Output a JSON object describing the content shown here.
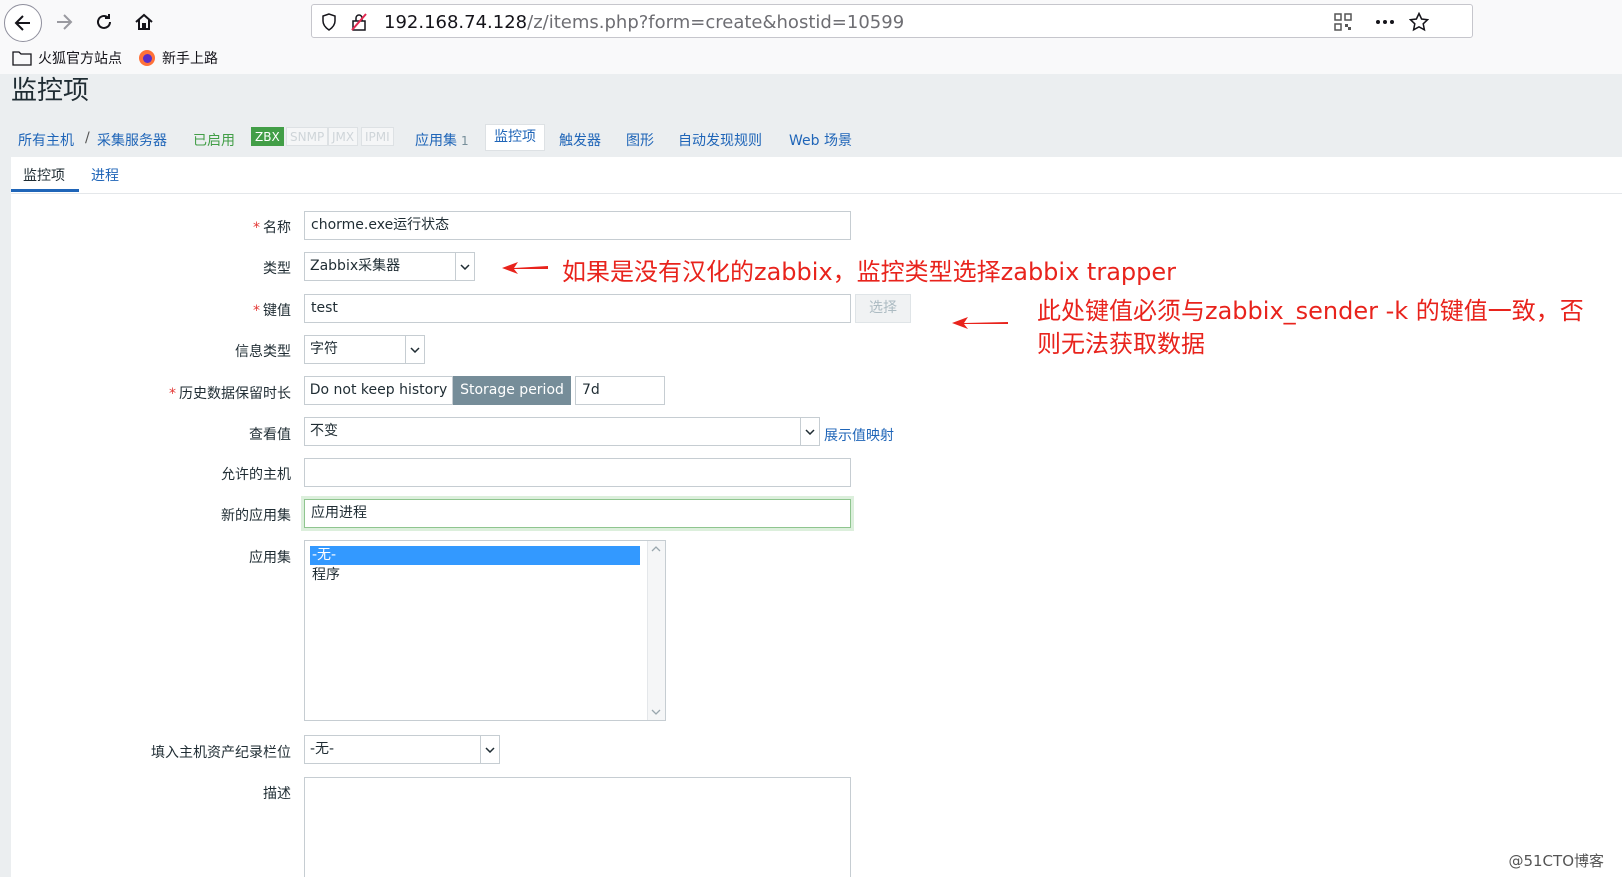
{
  "browser": {
    "url_host": "192.168.74.128",
    "url_path": "/z/items.php?form=create&hostid=10599",
    "bookmarks": [
      "火狐官方站点",
      "新手上路"
    ]
  },
  "page": {
    "title": "监控项"
  },
  "host_nav": {
    "all_hosts": "所有主机",
    "separator": "/",
    "host": "采集服务器",
    "status": "已启用",
    "availability": [
      "ZBX",
      "SNMP",
      "JMX",
      "IPMI"
    ],
    "applications": "应用集",
    "applications_count": "1",
    "items": "监控项",
    "triggers": "触发器",
    "graphs": "图形",
    "discovery": "自动发现规则",
    "web": "Web 场景"
  },
  "tabs": [
    "监控项",
    "进程"
  ],
  "form": {
    "required_mark": "*",
    "name_label": "名称",
    "name_value": "chorme.exe运行状态",
    "type_label": "类型",
    "type_value": "Zabbix采集器",
    "key_label": "键值",
    "key_value": "test",
    "select_button": "选择",
    "info_type_label": "信息类型",
    "info_type_value": "字符",
    "history_label": "历史数据保留时长",
    "history_options": [
      "Do not keep history",
      "Storage period"
    ],
    "history_value": "7d",
    "show_value_label": "查看值",
    "show_value_value": "不变",
    "show_value_link": "展示值映射",
    "allowed_hosts_label": "允许的主机",
    "allowed_hosts_value": "",
    "new_app_label": "新的应用集",
    "new_app_value": "应用进程",
    "apps_label": "应用集",
    "apps_options": [
      "-无-",
      "程序"
    ],
    "inventory_label": "填入主机资产纪录栏位",
    "inventory_value": "-无-",
    "description_label": "描述"
  },
  "annotations": {
    "note1": "如果是没有汉化的zabbix，监控类型选择zabbix trapper",
    "note2_line1": "此处键值必须与zabbix_sender -k 的键值一致，否",
    "note2_line2": "则无法获取数据"
  },
  "watermark": "@51CTO博客",
  "colors": {
    "accent": "#1f65b8",
    "enabled": "#429e47",
    "annotation": "#e8231c",
    "selected": "#3399ff"
  }
}
